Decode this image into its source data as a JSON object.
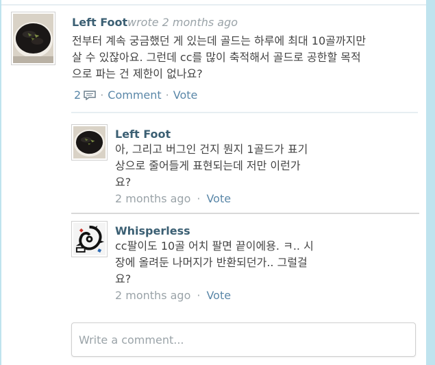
{
  "main_comment": {
    "author": "Left Foot",
    "meta": "wrote 2 months ago",
    "lines": [
      "전부터 계속 궁금했던 게 있는데 골드는 하루에 최대 10골까지만",
      "살 수 있잖아요. 그런데 cc를 많이 축적해서 골드로 공한할 목적",
      "으로 파는 건 제한이 없나요?"
    ],
    "reply_count": "2",
    "comment_label": "Comment",
    "vote_label": "Vote"
  },
  "replies": [
    {
      "author": "Left Foot",
      "lines": [
        "아, 그리고 버그인 건지 뭔지 1골드가 표기",
        "상으로 줄어들게 표현되는데 저만 이런가",
        "요?"
      ],
      "time": "2 months ago",
      "vote_label": "Vote"
    },
    {
      "author": "Whisperless",
      "lines": [
        "cc팔이도 10골 어치 팔면 끝이에용. ㅋ.. 시",
        "장에 올려둔 나머지가 반환되던가.. 그럴걸",
        "요?"
      ],
      "time": "2 months ago",
      "vote_label": "Vote"
    }
  ],
  "reply_box": {
    "placeholder": "Write a comment..."
  },
  "colors": {
    "author": "#3b5f73",
    "link": "#5a87a8",
    "muted": "#9aa3a8",
    "frame": "#bfe3ee"
  },
  "icons": {
    "comment_count": "speech-bubble-icon",
    "avatar_logo": "lego-logo"
  }
}
